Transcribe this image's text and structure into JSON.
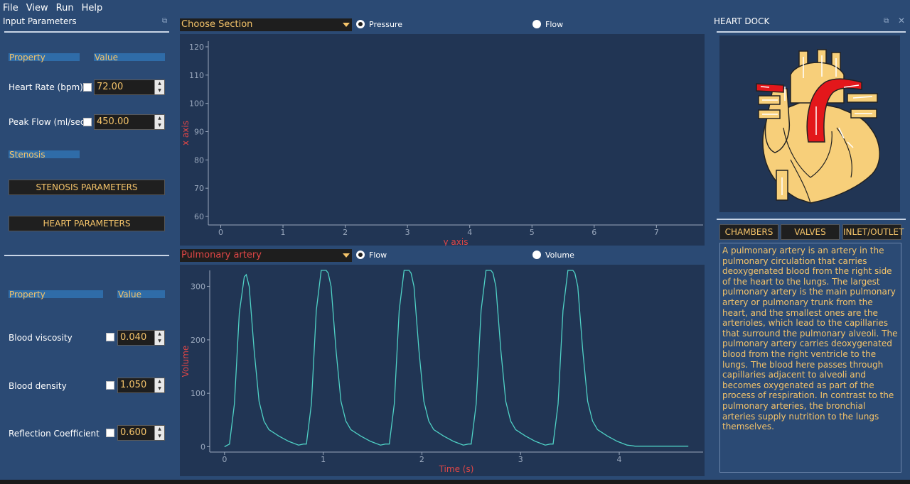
{
  "menu": [
    "File",
    "View",
    "Run",
    "Help"
  ],
  "input_panel": {
    "title": "Input Parameters",
    "property_hdr": "Property",
    "value_hdr": "Value",
    "heart_rate_label": "Heart Rate (bpm)",
    "heart_rate_value": "72.00",
    "peak_flow_label": "Peak Flow (ml/sec)",
    "peak_flow_value": "450.00",
    "stenosis_label": "Stenosis",
    "stenosis_button": "STENOSIS PARAMETERS",
    "heart_button": "HEART PARAMETERS",
    "property_hdr2": "Property",
    "value_hdr2": "Value",
    "viscosity_label": "Blood viscosity",
    "viscosity_value": "0.040",
    "density_label": "Blood density",
    "density_value": "1.050",
    "reflection_label": "Reflection Coefficient",
    "reflection_value": "0.600"
  },
  "top_plot": {
    "section_combo": "Choose Section",
    "radio1": "Pressure",
    "radio2": "Flow",
    "selected": "Pressure",
    "xlabel": "y axis",
    "ylabel": "x axis"
  },
  "bottom_plot": {
    "section_combo": "Pulmonary artery",
    "radio1": "Flow",
    "radio2": "Volume",
    "selected": "Flow",
    "xlabel": "Time (s)",
    "ylabel": "Volume"
  },
  "chart_data": [
    {
      "type": "line",
      "title": "",
      "xlabel": "y axis",
      "ylabel": "x axis",
      "xlim": [
        -0.2,
        7.75
      ],
      "ylim": [
        57,
        122
      ],
      "xticks": [
        0,
        1,
        2,
        3,
        4,
        5,
        6,
        7
      ],
      "yticks": [
        60,
        70,
        80,
        90,
        100,
        110,
        120
      ],
      "series": []
    },
    {
      "type": "line",
      "title": "",
      "xlabel": "Time (s)",
      "ylabel": "Volume",
      "xlim": [
        -0.15,
        4.85
      ],
      "ylim": [
        -10,
        330
      ],
      "xticks": [
        0,
        1,
        2,
        3,
        4
      ],
      "yticks": [
        0,
        100,
        200,
        300
      ],
      "color": "#4fd1c5",
      "series": [
        {
          "x": [
            0,
            0.05,
            0.1,
            0.15,
            0.2,
            0.22,
            0.25,
            0.3,
            0.35,
            0.4,
            0.45,
            0.55,
            0.65,
            0.75,
            0.8,
            0.83,
            0.88,
            0.93,
            0.98,
            1.03,
            1.05,
            1.08,
            1.13,
            1.18,
            1.23,
            1.28,
            1.38,
            1.48,
            1.58,
            1.63,
            1.67,
            1.72,
            1.77,
            1.82,
            1.87,
            1.89,
            1.92,
            1.97,
            2.02,
            2.07,
            2.12,
            2.22,
            2.32,
            2.42,
            2.47,
            2.5,
            2.55,
            2.6,
            2.65,
            2.7,
            2.72,
            2.75,
            2.8,
            2.85,
            2.9,
            2.95,
            3.05,
            3.15,
            3.25,
            3.3,
            3.33,
            3.38,
            3.43,
            3.48,
            3.53,
            3.55,
            3.58,
            3.63,
            3.68,
            3.73,
            3.78,
            3.88,
            3.98,
            4.08,
            4.13,
            4.16,
            4.7
          ],
          "values": [
            0,
            5,
            80,
            250,
            318,
            322,
            300,
            180,
            85,
            48,
            32,
            20,
            10,
            3,
            5,
            5,
            80,
            255,
            330,
            330,
            325,
            300,
            180,
            85,
            48,
            32,
            20,
            10,
            3,
            5,
            5,
            80,
            255,
            330,
            330,
            325,
            300,
            180,
            85,
            48,
            32,
            20,
            10,
            3,
            5,
            5,
            80,
            255,
            330,
            330,
            325,
            300,
            180,
            85,
            48,
            32,
            20,
            10,
            3,
            5,
            5,
            80,
            255,
            330,
            330,
            325,
            300,
            180,
            85,
            48,
            32,
            20,
            10,
            3,
            2,
            1,
            1
          ]
        }
      ]
    }
  ],
  "heart_panel": {
    "title": "HEART DOCK",
    "tab_chambers": "CHAMBERS",
    "tab_valves": "VALVES",
    "tab_inlet": "INLET/OUTLET",
    "description": "A pulmonary artery is an artery in the pulmonary circulation that carries deoxygenated blood from the right side of the heart to the lungs. The largest pulmonary artery is the main pulmonary artery or pulmonary trunk from the heart, and the smallest ones are the arterioles, which lead to the capillaries that surround the pulmonary alveoli. The pulmonary artery carries deoxygenated blood from the right ventricle to the lungs. The blood here passes through capillaries adjacent to alveoli and becomes oxygenated as part of the process of respiration. In contrast to the pulmonary arteries, the bronchial arteries supply nutrition to the lungs themselves."
  },
  "colors": {
    "background": "#2b4a74",
    "plot_bg": "#213554",
    "accent": "#f5c46a",
    "axis_label": "#e04646",
    "curve": "#4fd1c5",
    "heart_fill": "#f7cf7a",
    "artery_red": "#e3171b"
  }
}
